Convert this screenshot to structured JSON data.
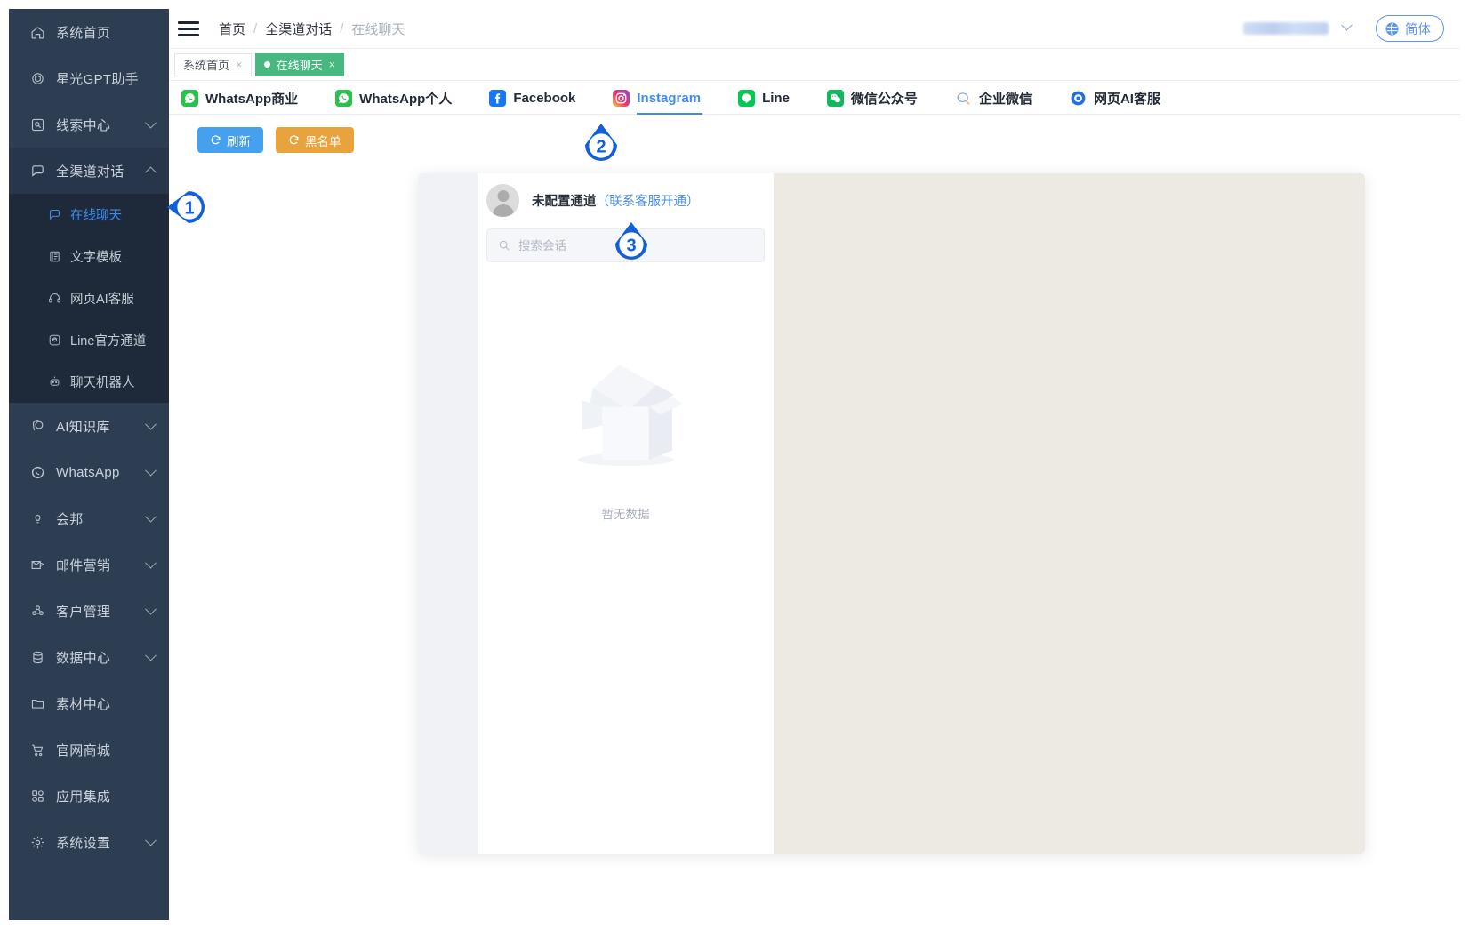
{
  "sidebar": {
    "items": [
      {
        "label": "系统首页",
        "icon": "home-icon",
        "expandable": false
      },
      {
        "label": "星光GPT助手",
        "icon": "gpt-icon",
        "expandable": false
      },
      {
        "label": "线索中心",
        "icon": "lead-icon",
        "expandable": true
      },
      {
        "label": "全渠道对话",
        "icon": "chat-icon",
        "expandable": true,
        "expanded": true
      }
    ],
    "submenu": [
      {
        "label": "在线聊天",
        "icon": "chat-bubble-icon",
        "active": true
      },
      {
        "label": "文字模板",
        "icon": "template-icon",
        "active": false
      },
      {
        "label": "网页AI客服",
        "icon": "headset-icon",
        "active": false
      },
      {
        "label": "Line官方通道",
        "icon": "line-icon",
        "active": false
      },
      {
        "label": "聊天机器人",
        "icon": "robot-icon",
        "active": false
      }
    ],
    "items_after": [
      {
        "label": "AI知识库",
        "icon": "brain-icon",
        "expandable": true
      },
      {
        "label": "WhatsApp",
        "icon": "whatsapp-icon",
        "expandable": true
      },
      {
        "label": "会邦",
        "icon": "bulb-icon",
        "expandable": true
      },
      {
        "label": "邮件营销",
        "icon": "mail-icon",
        "expandable": true
      },
      {
        "label": "客户管理",
        "icon": "users-icon",
        "expandable": true
      },
      {
        "label": "数据中心",
        "icon": "database-icon",
        "expandable": true
      },
      {
        "label": "素材中心",
        "icon": "folder-icon",
        "expandable": false
      },
      {
        "label": "官网商城",
        "icon": "cart-icon",
        "expandable": false
      },
      {
        "label": "应用集成",
        "icon": "grid-icon",
        "expandable": false
      },
      {
        "label": "系统设置",
        "icon": "gear-icon",
        "expandable": true
      }
    ]
  },
  "header": {
    "menu_icon": "hamburger-icon",
    "breadcrumb": [
      "首页",
      "全渠道对话",
      "在线聊天"
    ],
    "breadcrumb_separator": "/",
    "language_button": {
      "label": "简体",
      "icon": "globe-icon"
    },
    "user_caret_icon": "chevron-down-icon"
  },
  "page_tabs": [
    {
      "label": "系统首页",
      "active": false,
      "close": "×"
    },
    {
      "label": "在线聊天",
      "active": true,
      "close": "×"
    }
  ],
  "channels": [
    {
      "label": "WhatsApp商业",
      "icon": "whatsapp-icon",
      "active": false
    },
    {
      "label": "WhatsApp个人",
      "icon": "whatsapp-icon",
      "active": false
    },
    {
      "label": "Facebook",
      "icon": "facebook-icon",
      "active": false
    },
    {
      "label": "Instagram",
      "icon": "instagram-icon",
      "active": true
    },
    {
      "label": "Line",
      "icon": "line-icon",
      "active": false
    },
    {
      "label": "微信公众号",
      "icon": "wechat-icon",
      "active": false
    },
    {
      "label": "企业微信",
      "icon": "wecom-icon",
      "active": false
    },
    {
      "label": "网页AI客服",
      "icon": "web-ai-icon",
      "active": false
    }
  ],
  "actions": [
    {
      "label": "刷新",
      "icon": "refresh-icon",
      "color": "#46A0F0"
    },
    {
      "label": "黑名单",
      "icon": "refresh-icon",
      "color": "#E8A33D"
    }
  ],
  "panel": {
    "channel_status": "未配置通道",
    "channel_status_link": "（联系客服开通）",
    "search_placeholder": "搜索会话",
    "search_value": "",
    "search_icon": "search-icon",
    "empty_text": "暂无数据",
    "empty_illustration": "empty-box-icon"
  },
  "markers": [
    {
      "number": "1",
      "direction": "left"
    },
    {
      "number": "2",
      "direction": "up"
    },
    {
      "number": "3",
      "direction": "up"
    }
  ],
  "colors": {
    "sidebar_bg": "#2E3E52",
    "submenu_bg": "#1E2A3A",
    "accent_blue": "#3F8BF0",
    "tab_active_green": "#48B881",
    "refresh_blue": "#46A0F0",
    "blacklist_orange": "#E8A33D",
    "chat_area_beige": "#EDE9E3",
    "marker_blue": "#1160D8"
  }
}
